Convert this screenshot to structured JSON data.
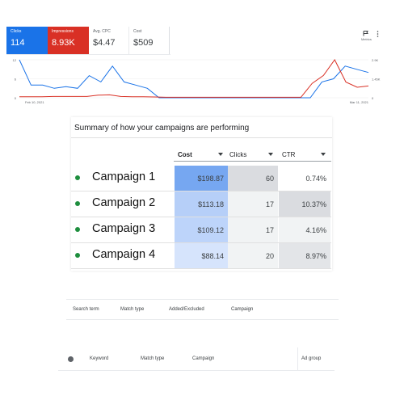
{
  "metrics": [
    {
      "label": "Clicks",
      "value": "114"
    },
    {
      "label": "Impressions",
      "value": "8.93K"
    },
    {
      "label": "Avg. CPC",
      "value": "$4.47"
    },
    {
      "label": "Cost",
      "value": "$509"
    }
  ],
  "toolbar": {
    "metrics_label": "Metrics",
    "metrics_icon": "chart-flag-icon",
    "more_icon": "more-vert-icon"
  },
  "colors": {
    "clicks": "#1a73e8",
    "impressions": "#d93025",
    "green_dot": "#1e8e3e",
    "cost_scale": [
      "#76a7f1",
      "#a8c7fa",
      "#bcd4fb",
      "#d6e4fc"
    ]
  },
  "chart_data": {
    "type": "line",
    "x_start_label": "Feb 10, 2021",
    "x_end_label": "Mar 11, 2021",
    "left_axis": {
      "ticks": [
        "12",
        "6",
        "0"
      ],
      "max": 12
    },
    "right_axis": {
      "ticks": [
        "2.9K",
        "1.45K",
        "0"
      ],
      "max": 2900
    },
    "series": [
      {
        "name": "Clicks",
        "axis": "left",
        "values": [
          12,
          4,
          4,
          3,
          3.5,
          3,
          7,
          5,
          10,
          5,
          4,
          3,
          0,
          0,
          0,
          0,
          0,
          0,
          0,
          0,
          0,
          0,
          0,
          0,
          0,
          0,
          5,
          6,
          10,
          9,
          8
        ]
      },
      {
        "name": "Impressions",
        "axis": "right",
        "values": [
          80,
          80,
          80,
          100,
          100,
          100,
          100,
          200,
          220,
          100,
          80,
          80,
          60,
          40,
          40,
          40,
          40,
          40,
          40,
          40,
          40,
          40,
          40,
          40,
          40,
          40,
          1100,
          1700,
          2900,
          1200,
          800,
          900
        ]
      }
    ]
  },
  "summary": {
    "title": "Summary of how your campaigns are performing",
    "columns": [
      "Cost",
      "Clicks",
      "CTR"
    ],
    "rows": [
      {
        "name": "Campaign 1",
        "cost": "$198.87",
        "clicks": "60",
        "ctr": "0.74%"
      },
      {
        "name": "Campaign 2",
        "cost": "$113.18",
        "clicks": "17",
        "ctr": "10.37%"
      },
      {
        "name": "Campaign 3",
        "cost": "$109.12",
        "clicks": "17",
        "ctr": "4.16%"
      },
      {
        "name": "Campaign 4",
        "cost": "$88.14",
        "clicks": "20",
        "ctr": "8.97%"
      }
    ]
  },
  "search_terms_header": [
    "Search term",
    "Match type",
    "Added/Excluded",
    "Campaign"
  ],
  "keywords_header": [
    "Keyword",
    "Match type",
    "Campaign",
    "Ad group"
  ]
}
